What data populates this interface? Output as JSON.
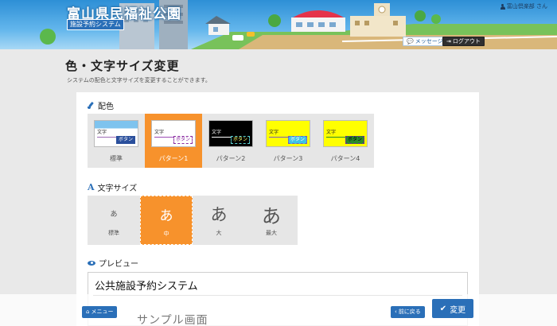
{
  "header": {
    "site_title": "富山県民福祉公園",
    "system_name": "施設予約システム",
    "user_name": "富山倶楽部 さん",
    "message_label": "メッセージ",
    "logout_label": "ログアウト"
  },
  "page": {
    "title": "色・文字サイズ変更",
    "description": "システムの配色と文字サイズを変更することができます。"
  },
  "color_section": {
    "title": "配色",
    "swatch_text": "文字",
    "swatch_button": "ボタン",
    "options": [
      {
        "label": "標準",
        "bg": "#ffffff",
        "text_color": "#222222",
        "line": "#9c6ab5",
        "btn_bg": "#2a4f9c",
        "btn_text": "#ffffff",
        "btn_border": "#2a4f9c"
      },
      {
        "label": "パターン1",
        "bg": "#ffffff",
        "text_color": "#222222",
        "line": "#9c4ab5",
        "btn_bg": "#ffffff",
        "btn_text": "#8a2aa0",
        "btn_border": "#8a2aa0"
      },
      {
        "label": "パターン2",
        "bg": "#000000",
        "text_color": "#ffffff",
        "line": "#ffffff",
        "btn_bg": "#000000",
        "btn_text": "#ffff66",
        "btn_border": "#5ad0d0"
      },
      {
        "label": "パターン3",
        "bg": "#ffff00",
        "text_color": "#222222",
        "line": "#7a5abf",
        "btn_bg": "#3ec2e6",
        "btn_text": "#ffffff",
        "btn_border": "#7a5abf"
      },
      {
        "label": "パターン4",
        "bg": "#ffff00",
        "text_color": "#222222",
        "line": "#2a8a2a",
        "btn_bg": "#2a8a2a",
        "btn_text": "#000000",
        "btn_border": "#6a2aa0"
      }
    ],
    "selected_index": 1
  },
  "font_section": {
    "title": "文字サイズ",
    "glyph": "あ",
    "options": [
      {
        "label": "標準"
      },
      {
        "label": "中"
      },
      {
        "label": "大"
      },
      {
        "label": "最大"
      }
    ],
    "selected_index": 1
  },
  "preview_section": {
    "title": "プレビュー",
    "heading": "公共施設予約システム",
    "sample_text": "サンプル画面"
  },
  "footer": {
    "menu_label": "メニュー",
    "back_label": "前に戻る",
    "change_label": "変更"
  },
  "colors": {
    "accent_orange": "#f7922c",
    "primary_blue": "#2a6fb8",
    "option_gray": "#e6e6e6"
  }
}
